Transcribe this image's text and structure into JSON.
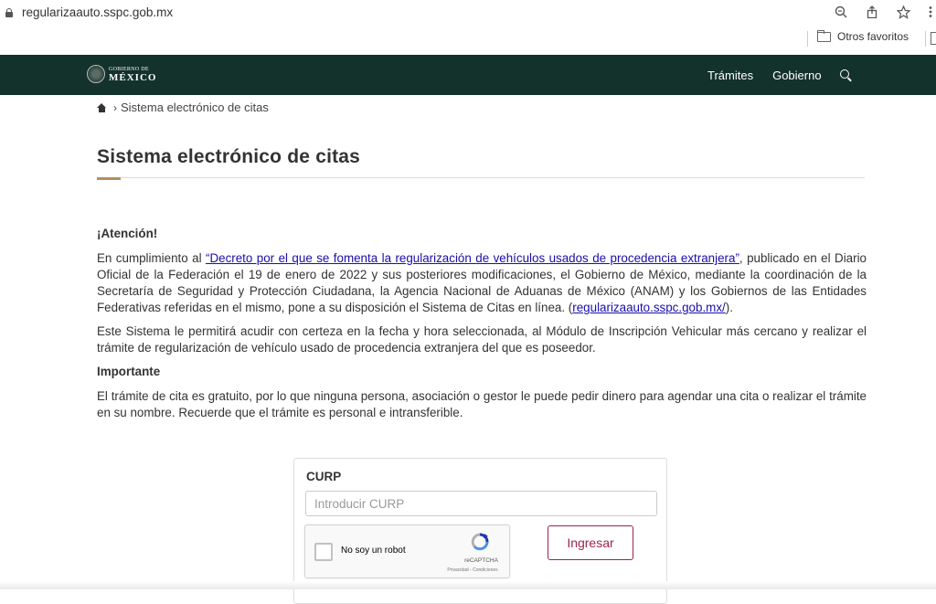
{
  "browser": {
    "url": "regularizaauto.sspc.gob.mx",
    "bookmark_folder": "Otros favoritos",
    "icons": [
      "zoom-icon",
      "share-icon",
      "star-icon",
      "menu-icon"
    ]
  },
  "navbar": {
    "logo_small": "GOBIERNO DE",
    "logo_big": "MÉXICO",
    "links": [
      "Trámites",
      "Gobierno"
    ],
    "bg_color": "#13322b"
  },
  "breadcrumb": {
    "separator": "›",
    "current": "Sistema electrónico de citas"
  },
  "page": {
    "title": "Sistema electrónico de citas",
    "accent_color": "#b38e5d"
  },
  "content": {
    "attention_heading": "¡Atención!",
    "p1_before": "En cumplimiento al ",
    "p1_link": "“Decreto por el que se fomenta la regularización de vehículos usados de procedencia extranjera”",
    "p1_after": ", publicado en el Diario Oficial de la Federación el 19 de enero de 2022 y sus posteriores modificaciones, el Gobierno de México, mediante la coordinación de la Secretaría de Seguridad y Protección Ciudadana, la Agencia Nacional de Aduanas de México (ANAM) y los Gobiernos de las Entidades Federativas referidas en el mismo, pone a su disposición el Sistema de Citas en línea. (",
    "p1_link2": "regularizaauto.sspc.gob.mx/",
    "p1_end": ").",
    "p2": "Este Sistema le permitirá acudir con certeza en la fecha y hora seleccionada, al Módulo de Inscripción Vehicular más cercano y realizar el trámite de regularización de vehículo usado de procedencia extranjera del que es poseedor.",
    "important_heading": "Importante",
    "p3": "El trámite de cita es gratuito, por lo que ninguna persona, asociación o gestor le puede pedir dinero para agendar una cita o realizar el trámite en su nombre. Recuerde que el trámite es personal e intransferible."
  },
  "form": {
    "curp_label": "CURP",
    "curp_placeholder": "Introducir CURP",
    "curp_value": "",
    "captcha_label": "No soy un robot",
    "captcha_brand": "reCAPTCHA",
    "captcha_terms": "Privacidad - Condiciones",
    "submit_label": "Ingresar",
    "submit_color": "#9d2449"
  }
}
